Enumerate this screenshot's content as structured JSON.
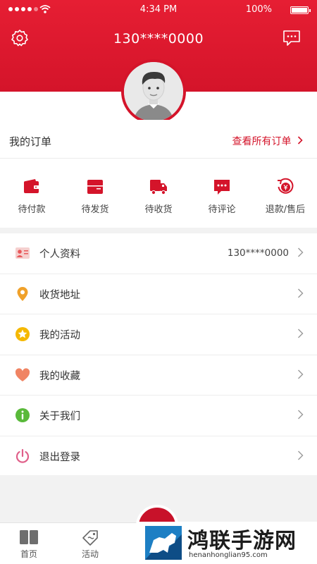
{
  "status_bar": {
    "time": "4:34 PM",
    "battery": "100%",
    "signal_bars": 4
  },
  "header": {
    "phone": "130****0000",
    "settings_icon": "gear-icon",
    "message_icon": "chat-bubble-icon",
    "color": "#d4142a"
  },
  "orders": {
    "title": "我的订单",
    "view_all": "查看所有订单",
    "items": [
      {
        "label": "待付款",
        "icon": "wallet-icon"
      },
      {
        "label": "待发货",
        "icon": "package-icon"
      },
      {
        "label": "待收货",
        "icon": "truck-icon"
      },
      {
        "label": "待评论",
        "icon": "comment-icon"
      },
      {
        "label": "退款/售后",
        "icon": "refund-icon"
      }
    ]
  },
  "menu": [
    {
      "label": "个人资料",
      "value": "130****0000",
      "icon": "profile-card-icon",
      "color": "#e8585a"
    },
    {
      "label": "收货地址",
      "value": "",
      "icon": "location-pin-icon",
      "color": "#f0a12a"
    },
    {
      "label": "我的活动",
      "value": "",
      "icon": "star-icon",
      "color": "#f5b800"
    },
    {
      "label": "我的收藏",
      "value": "",
      "icon": "heart-icon",
      "color": "#f08463"
    },
    {
      "label": "关于我们",
      "value": "",
      "icon": "info-icon",
      "color": "#59b93a"
    },
    {
      "label": "退出登录",
      "value": "",
      "icon": "power-icon",
      "color": "#e0608a"
    }
  ],
  "tabbar": {
    "home": "首页",
    "activity": "活动"
  },
  "watermark": {
    "title": "鸿联手游网",
    "url": "henanhonglian95.com"
  }
}
